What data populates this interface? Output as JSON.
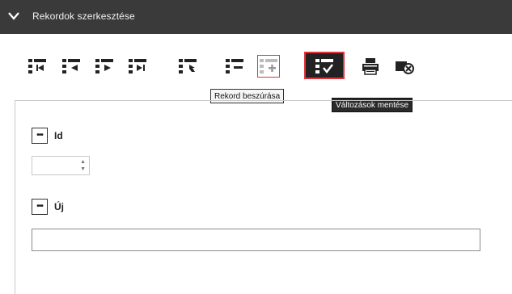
{
  "header": {
    "title": "Rekordok szerkesztése"
  },
  "toolbar": {
    "buttons": [
      {
        "id": "first",
        "icon": "first-record-icon"
      },
      {
        "id": "prev",
        "icon": "previous-record-icon"
      },
      {
        "id": "next",
        "icon": "next-record-icon"
      },
      {
        "id": "last",
        "icon": "last-record-icon"
      },
      {
        "id": "refresh",
        "icon": "refresh-records-icon"
      },
      {
        "id": "delete",
        "icon": "delete-record-icon"
      },
      {
        "id": "insert",
        "icon": "insert-record-icon"
      },
      {
        "id": "save",
        "icon": "save-changes-icon"
      },
      {
        "id": "print",
        "icon": "print-icon"
      },
      {
        "id": "cancel",
        "icon": "cancel-edit-icon"
      }
    ],
    "tooltips": {
      "insert": "Rekord beszúrása",
      "save": "Változások mentése"
    }
  },
  "form": {
    "fields": [
      {
        "label": "Id",
        "value": "",
        "type": "number"
      },
      {
        "label": "Új",
        "value": "",
        "type": "text"
      }
    ]
  },
  "colors": {
    "header_bg": "#3a3a3a",
    "accent": "#e2333b"
  }
}
